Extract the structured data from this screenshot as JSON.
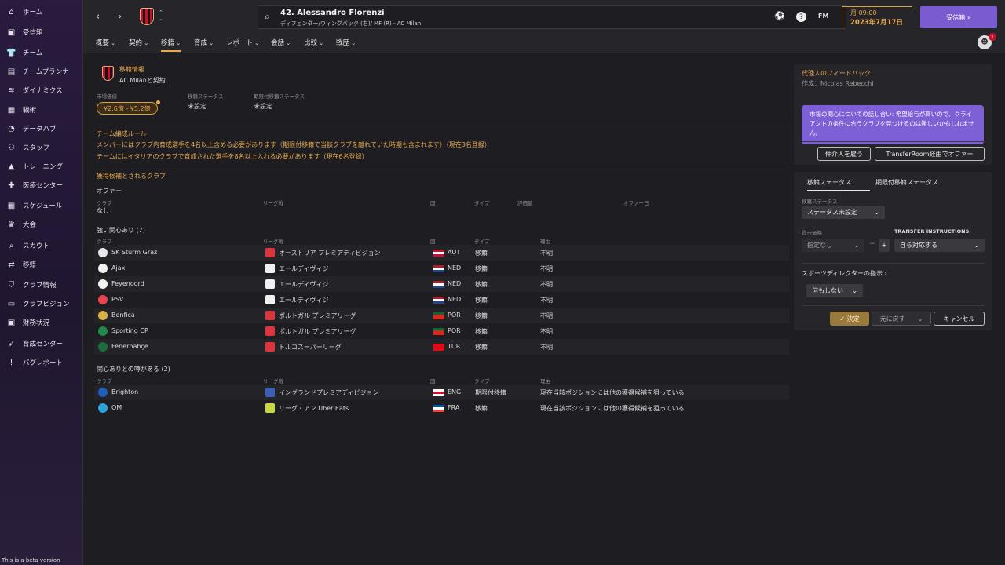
{
  "sidebar": {
    "items": [
      {
        "label": "ホーム",
        "icon": "home-icon",
        "glyph": "⌂"
      },
      {
        "label": "受信箱",
        "icon": "inbox-icon",
        "glyph": "▣"
      },
      {
        "label": "チーム",
        "icon": "shirt-icon",
        "glyph": "👕"
      },
      {
        "label": "チームプランナー",
        "icon": "clipboard-icon",
        "glyph": "▤"
      },
      {
        "label": "ダイナミクス",
        "icon": "dynamics-icon",
        "glyph": "≋"
      },
      {
        "label": "戦術",
        "icon": "tactics-icon",
        "glyph": "▦"
      },
      {
        "label": "データハブ",
        "icon": "data-hub-icon",
        "glyph": "◔"
      },
      {
        "label": "スタッフ",
        "icon": "staff-icon",
        "glyph": "⚇"
      },
      {
        "label": "トレーニング",
        "icon": "training-icon",
        "glyph": "▲"
      },
      {
        "label": "医療センター",
        "icon": "medical-icon",
        "glyph": "✚"
      },
      {
        "label": "スケジュール",
        "icon": "calendar-icon",
        "glyph": "▦"
      },
      {
        "label": "大会",
        "icon": "trophy-icon",
        "glyph": "♛"
      },
      {
        "label": "スカウト",
        "icon": "scout-icon",
        "glyph": "⌕"
      },
      {
        "label": "移籍",
        "icon": "transfer-icon",
        "glyph": "⇄"
      },
      {
        "label": "クラブ情報",
        "icon": "club-info-icon",
        "glyph": "⛉"
      },
      {
        "label": "クラブビジョン",
        "icon": "club-vision-icon",
        "glyph": "▭"
      },
      {
        "label": "財務状況",
        "icon": "finance-icon",
        "glyph": "▣"
      },
      {
        "label": "育成センター",
        "icon": "development-icon",
        "glyph": "➶"
      },
      {
        "label": "バグレポート",
        "icon": "bug-report-icon",
        "glyph": "!"
      }
    ],
    "beta": "This is a beta version"
  },
  "header": {
    "player_name": "42. Alessandro Florenzi",
    "player_sub": "ディフェンダー/ウィングバック (右)/ MF (R) - AC Milan",
    "fm": "FM",
    "date_top": "月 09:00",
    "date_bottom": "2023年7月17日",
    "inbox_button": "受信箱  »",
    "badge_count": "1"
  },
  "tabs": [
    "概要",
    "契約",
    "移籍",
    "育成",
    "レポート",
    "会話",
    "比較",
    "戦歴"
  ],
  "active_tab": 2,
  "transfer_info": {
    "title": "移籍情報",
    "contract": "AC Milanと契約",
    "market_value_label": "市場価値",
    "market_value": "¥2.6億 - ¥5.2億",
    "transfer_status_label": "移籍ステータス",
    "transfer_status": "未設定",
    "loan_status_label": "期限付移籍ステータス",
    "loan_status": "未設定"
  },
  "rules": {
    "title": "チーム編成ルール",
    "line1": "メンバーにはクラブ内育成選手を4名以上含める必要があります（期限付移籍で当該クラブを離れていた時期も含まれます）（現在3名登録）",
    "line2": "チームにはイタリアのクラブで育成された選手を8名以上入れる必要があります（現在6名登録）"
  },
  "clubs": {
    "title": "獲得候補とされるクラブ",
    "offers": {
      "title": "オファー",
      "headers": [
        "クラブ",
        "リーグ戦",
        "国",
        "タイプ",
        "評価額",
        "オファー日"
      ],
      "none": "なし"
    },
    "strong": {
      "title": "強い関心あり (7)",
      "headers": [
        "クラブ",
        "リーグ戦",
        "国",
        "タイプ",
        "理由"
      ],
      "rows": [
        {
          "club": "SK Sturm Graz",
          "league": "オーストリア プレミアディビジョン",
          "country": "AUT",
          "type": "移籍",
          "reason": "不明",
          "club_color": "#e8e8e8",
          "league_color": "#d9363e",
          "flag": [
            "#c8102e",
            "#ffffff",
            "#c8102e"
          ]
        },
        {
          "club": "Ajax",
          "league": "エールディヴィジ",
          "country": "NED",
          "type": "移籍",
          "reason": "不明",
          "club_color": "#f2f2f2",
          "league_color": "#f0f0f0",
          "flag": [
            "#ae1c28",
            "#ffffff",
            "#21468b"
          ]
        },
        {
          "club": "Feyenoord",
          "league": "エールディヴィジ",
          "country": "NED",
          "type": "移籍",
          "reason": "不明",
          "club_color": "#f2f2f2",
          "league_color": "#f0f0f0",
          "flag": [
            "#ae1c28",
            "#ffffff",
            "#21468b"
          ]
        },
        {
          "club": "PSV",
          "league": "エールディヴィジ",
          "country": "NED",
          "type": "移籍",
          "reason": "不明",
          "club_color": "#e8434e",
          "league_color": "#f0f0f0",
          "flag": [
            "#ae1c28",
            "#ffffff",
            "#21468b"
          ]
        },
        {
          "club": "Benfica",
          "league": "ポルトガル プレミアリーグ",
          "country": "POR",
          "type": "移籍",
          "reason": "不明",
          "club_color": "#d8b246",
          "league_color": "#d9363e",
          "flag": [
            "#046a38",
            "#da291c",
            "#da291c"
          ]
        },
        {
          "club": "Sporting CP",
          "league": "ポルトガル プレミアリーグ",
          "country": "POR",
          "type": "移籍",
          "reason": "不明",
          "club_color": "#1f8a4c",
          "league_color": "#d9363e",
          "flag": [
            "#046a38",
            "#da291c",
            "#da291c"
          ]
        },
        {
          "club": "Fenerbahçe",
          "league": "トルコスーパーリーグ",
          "country": "TUR",
          "type": "移籍",
          "reason": "不明",
          "club_color": "#1b6d3d",
          "league_color": "#d9363e",
          "flag": [
            "#e30a17",
            "#e30a17",
            "#e30a17"
          ]
        }
      ]
    },
    "rumour": {
      "title": "関心ありとの噂がある (2)",
      "headers": [
        "クラブ",
        "リーグ戦",
        "国",
        "タイプ",
        "理由"
      ],
      "rows": [
        {
          "club": "Brighton",
          "league": "イングランドプレミアディビジョン",
          "country": "ENG",
          "type": "期限付移籍",
          "reason": "現在当該ポジションには他の獲得候補を狙っている",
          "club_color": "#1f5ebd",
          "league_color": "#3a5fb5",
          "flag": [
            "#ffffff",
            "#ce1124",
            "#ffffff"
          ]
        },
        {
          "club": "OM",
          "league": "リーグ・アン Uber Eats",
          "country": "FRA",
          "type": "移籍",
          "reason": "現在当該ポジションには他の獲得候補を狙っている",
          "club_color": "#2aa4dd",
          "league_color": "#c9d64a",
          "flag": [
            "#0055a4",
            "#ffffff",
            "#ef4135"
          ]
        }
      ]
    }
  },
  "agent": {
    "title": "代理人のフィードバック",
    "author": "作成：Nicolas Rebecchi",
    "message": "市場の関心についての話し合い: 希望給与が高いので、クライアントの条件に合うクラブを見つけるのは難しいかもしれません。",
    "btn_hire": "仲介人を雇う",
    "btn_offer": "TransferRoom経由でオファー"
  },
  "status_panel": {
    "tab1": "移籍ステータス",
    "tab2": "期限付移籍ステータス",
    "status_label": "移籍ステータス",
    "status_value": "ステータス未設定",
    "price_label": "提示価格",
    "price_value": "指定なし",
    "instr_label": "TRANSFER INSTRUCTIONS",
    "instr_value": "自ら対応する",
    "director_label": "スポーツディレクターの指示 ›",
    "director_value": "何もしない",
    "btn_confirm": "✓ 決定",
    "btn_revert": "元に戻す",
    "btn_cancel": "キャンセル"
  }
}
